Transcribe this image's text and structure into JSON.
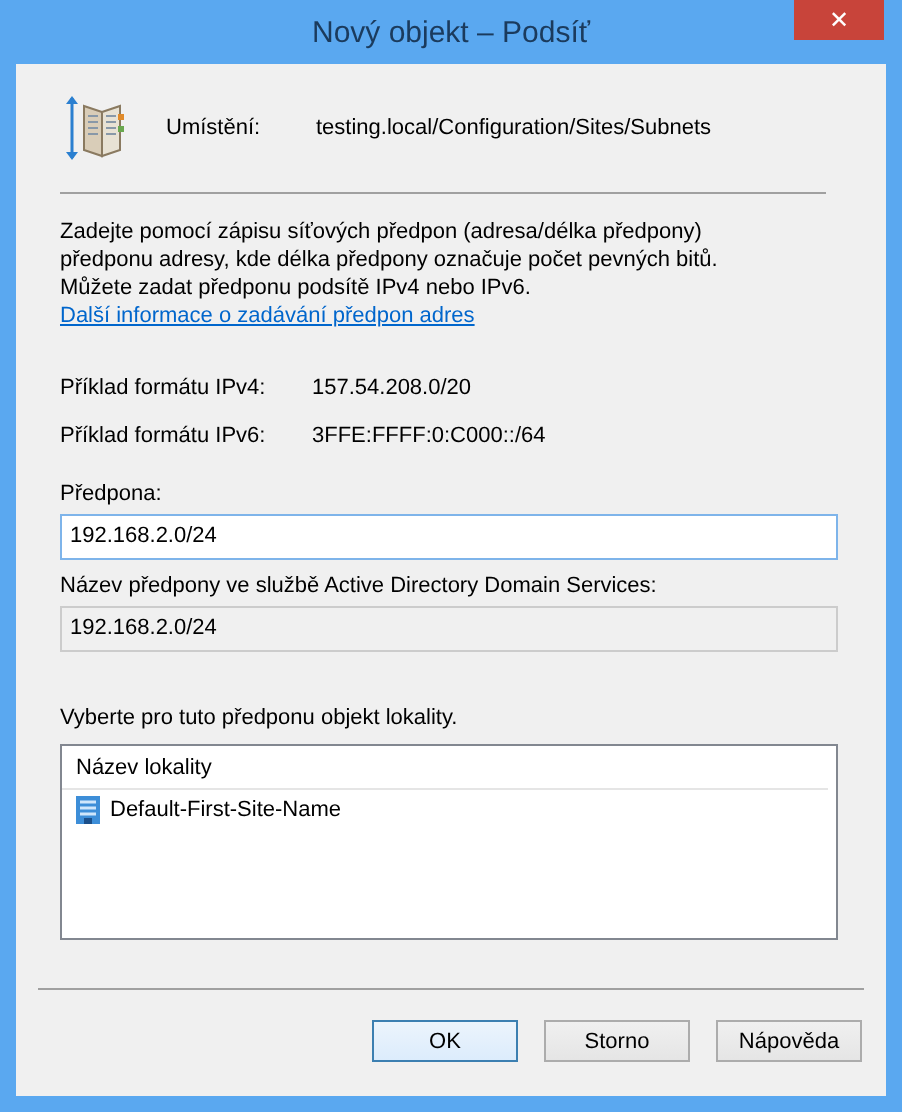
{
  "window": {
    "title": "Nový objekt – Podsíť",
    "close_glyph": "✕"
  },
  "location": {
    "label": "Umístění:",
    "value": "testing.local/Configuration/Sites/Subnets"
  },
  "description": "Zadejte pomocí zápisu síťových předpon (adresa/délka předpony) předponu adresy, kde délka předpony označuje počet pevných bitů. Můžete zadat předponu podsítě IPv4 nebo IPv6.",
  "help_link": "Další informace o zadávání předpon adres",
  "examples": [
    {
      "label": "Příklad formátu IPv4:",
      "value": "157.54.208.0/20"
    },
    {
      "label": "Příklad formátu IPv6:",
      "value": "3FFE:FFFF:0:C000::/64"
    }
  ],
  "prefix_field": {
    "label": "Předpona:",
    "value": "192.168.2.0/24",
    "focused": true,
    "disabled": false
  },
  "adds_field": {
    "label": "Název předpony ve službě Active Directory Domain Services:",
    "value": "192.168.2.0/24",
    "focused": false,
    "disabled": true
  },
  "site_list": {
    "prompt": "Vyberte pro tuto předponu objekt lokality.",
    "column": "Název lokality",
    "rows": [
      {
        "name": "Default-First-Site-Name",
        "selected": false
      }
    ]
  },
  "buttons": [
    {
      "label": "OK",
      "default": true
    },
    {
      "label": "Storno",
      "default": false
    },
    {
      "label": "Nápověda",
      "default": false
    }
  ]
}
